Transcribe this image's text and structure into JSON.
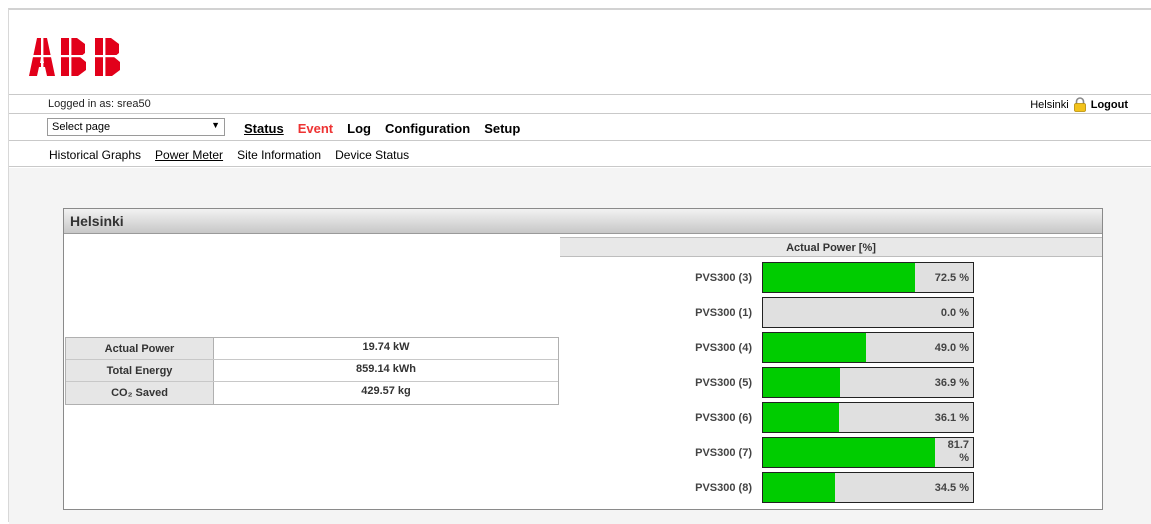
{
  "header": {
    "logo_text": "ABB"
  },
  "login_bar": {
    "logged_in_label": "Logged in as: srea50",
    "site": "Helsinki",
    "logout_label": "Logout"
  },
  "menu": {
    "select_page": "Select page",
    "nav": [
      "Status",
      "Event",
      "Log",
      "Configuration",
      "Setup"
    ]
  },
  "subnav": [
    "Historical Graphs",
    "Power Meter",
    "Site Information",
    "Device Status"
  ],
  "panel": {
    "title": "Helsinki",
    "stats": [
      {
        "label": "Actual Power",
        "value": "19.74 kW"
      },
      {
        "label": "Total Energy",
        "value": "859.14 kWh"
      },
      {
        "label": "CO₂  Saved",
        "value": "429.57 kg"
      }
    ],
    "actual_power_header": "Actual Power [%]",
    "devices": [
      {
        "name": "PVS300 (3)",
        "percent": 72.5,
        "label": "72.5 %"
      },
      {
        "name": "PVS300 (1)",
        "percent": 0.0,
        "label": "0.0 %"
      },
      {
        "name": "PVS300 (4)",
        "percent": 49.0,
        "label": "49.0 %"
      },
      {
        "name": "PVS300 (5)",
        "percent": 36.9,
        "label": "36.9 %"
      },
      {
        "name": "PVS300 (6)",
        "percent": 36.1,
        "label": "36.1 %"
      },
      {
        "name": "PVS300 (7)",
        "percent": 81.7,
        "label": "81.7 %"
      },
      {
        "name": "PVS300 (8)",
        "percent": 34.5,
        "label": "34.5 %"
      }
    ]
  },
  "colors": {
    "bar_fill": "#00cc00",
    "bar_bg": "#e0e0e0",
    "event_link": "#ee3333",
    "abb_red": "#e2001a"
  }
}
